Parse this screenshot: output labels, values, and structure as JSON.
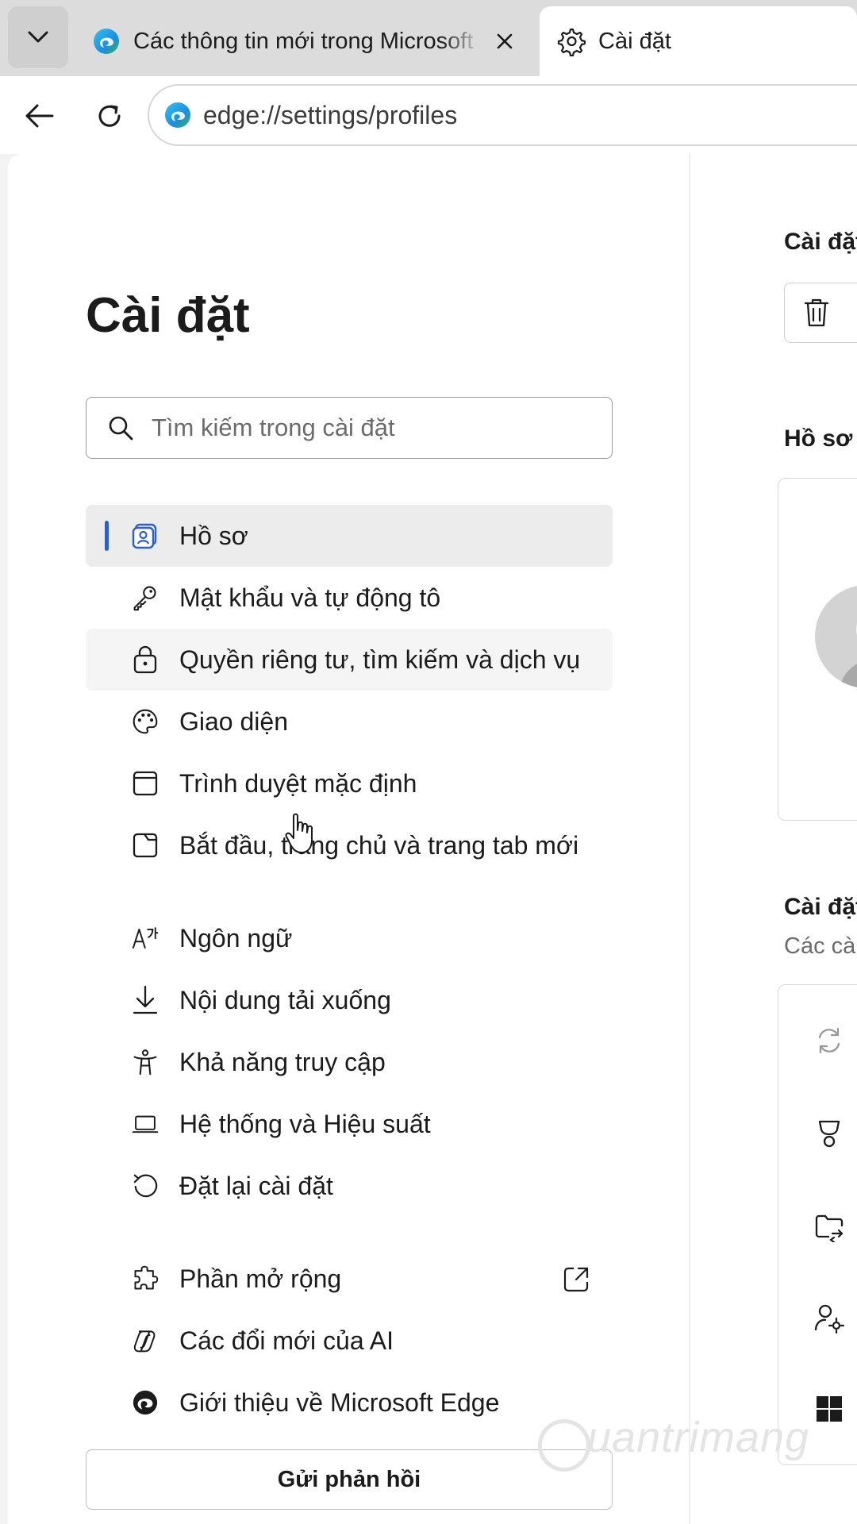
{
  "browser": {
    "tabs": [
      {
        "title": "Các thông tin mới trong Microsoft Edge",
        "icon": "edge-logo-icon"
      },
      {
        "title": "Cài đặt",
        "icon": "gear-icon",
        "active": true
      }
    ],
    "address_url": "edge://settings/profiles"
  },
  "sidebar": {
    "title": "Cài đặt",
    "search_placeholder": "Tìm kiếm trong cài đặt",
    "items": [
      {
        "label": "Hồ sơ",
        "icon": "profile-icon",
        "active": true
      },
      {
        "label": "Mật khẩu và tự động tô",
        "icon": "key-icon"
      },
      {
        "label": "Quyền riêng tư, tìm kiếm và dịch vụ",
        "icon": "lock-icon",
        "hovered": true
      },
      {
        "label": "Giao diện",
        "icon": "palette-icon"
      },
      {
        "label": "Trình duyệt mặc định",
        "icon": "browser-window-icon"
      },
      {
        "label": "Bắt đầu, trang chủ và trang tab mới",
        "icon": "home-tab-icon"
      },
      {
        "label": "Ngôn ngữ",
        "icon": "language-icon"
      },
      {
        "label": "Nội dung tải xuống",
        "icon": "download-icon"
      },
      {
        "label": "Khả năng truy cập",
        "icon": "accessibility-icon"
      },
      {
        "label": "Hệ thống và Hiệu suất",
        "icon": "laptop-icon"
      },
      {
        "label": "Đặt lại cài đặt",
        "icon": "reset-icon"
      },
      {
        "label": "Phần mở rộng",
        "icon": "puzzle-icon",
        "external": true
      },
      {
        "label": "Các đổi mới của AI",
        "icon": "ai-icon"
      },
      {
        "label": "Giới thiệu về Microsoft Edge",
        "icon": "edge-logo-icon"
      }
    ],
    "feedback_label": "Gửi phản hồi"
  },
  "content": {
    "section1_title": "Cài đặt",
    "section2_title": "Hồ sơ",
    "section3_title": "Cài đặt",
    "section3_subtitle": "Các cà"
  },
  "watermark": "uantrimang",
  "colors": {
    "accent": "#2f5fc4",
    "active_bg": "#ececec",
    "tabstrip_bg": "#dcdcdc"
  }
}
